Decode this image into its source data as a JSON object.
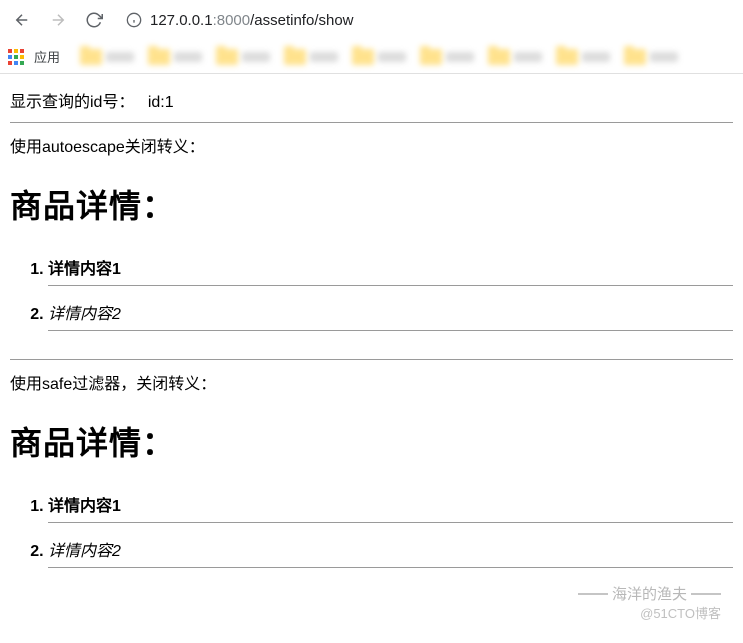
{
  "browser": {
    "url_host": "127.0.0.1",
    "url_port": ":8000",
    "url_path": "/assetinfo/show",
    "apps_label": "应用"
  },
  "page": {
    "id_line_label": "显示查询的id号：",
    "id_value": "id:1",
    "sections": [
      {
        "intro": "使用autoescape关闭转义：",
        "heading": "商品详情：",
        "items": [
          {
            "text": "详情内容1",
            "style": "bold"
          },
          {
            "text": "详情内容2",
            "style": "italic"
          }
        ]
      },
      {
        "intro": "使用safe过滤器，关闭转义：",
        "heading": "商品详情：",
        "items": [
          {
            "text": "详情内容1",
            "style": "bold"
          },
          {
            "text": "详情内容2",
            "style": "italic"
          }
        ]
      }
    ]
  },
  "watermark": {
    "line1": "海洋的渔夫",
    "line2": "@51CTO博客"
  }
}
